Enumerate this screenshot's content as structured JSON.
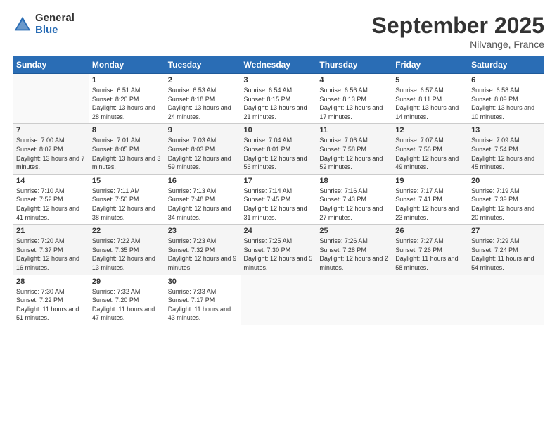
{
  "logo": {
    "general": "General",
    "blue": "Blue"
  },
  "title": "September 2025",
  "location": "Nilvange, France",
  "weekdays": [
    "Sunday",
    "Monday",
    "Tuesday",
    "Wednesday",
    "Thursday",
    "Friday",
    "Saturday"
  ],
  "weeks": [
    [
      {
        "day": "",
        "sunrise": "",
        "sunset": "",
        "daylight": ""
      },
      {
        "day": "1",
        "sunrise": "Sunrise: 6:51 AM",
        "sunset": "Sunset: 8:20 PM",
        "daylight": "Daylight: 13 hours and 28 minutes."
      },
      {
        "day": "2",
        "sunrise": "Sunrise: 6:53 AM",
        "sunset": "Sunset: 8:18 PM",
        "daylight": "Daylight: 13 hours and 24 minutes."
      },
      {
        "day": "3",
        "sunrise": "Sunrise: 6:54 AM",
        "sunset": "Sunset: 8:15 PM",
        "daylight": "Daylight: 13 hours and 21 minutes."
      },
      {
        "day": "4",
        "sunrise": "Sunrise: 6:56 AM",
        "sunset": "Sunset: 8:13 PM",
        "daylight": "Daylight: 13 hours and 17 minutes."
      },
      {
        "day": "5",
        "sunrise": "Sunrise: 6:57 AM",
        "sunset": "Sunset: 8:11 PM",
        "daylight": "Daylight: 13 hours and 14 minutes."
      },
      {
        "day": "6",
        "sunrise": "Sunrise: 6:58 AM",
        "sunset": "Sunset: 8:09 PM",
        "daylight": "Daylight: 13 hours and 10 minutes."
      }
    ],
    [
      {
        "day": "7",
        "sunrise": "Sunrise: 7:00 AM",
        "sunset": "Sunset: 8:07 PM",
        "daylight": "Daylight: 13 hours and 7 minutes."
      },
      {
        "day": "8",
        "sunrise": "Sunrise: 7:01 AM",
        "sunset": "Sunset: 8:05 PM",
        "daylight": "Daylight: 13 hours and 3 minutes."
      },
      {
        "day": "9",
        "sunrise": "Sunrise: 7:03 AM",
        "sunset": "Sunset: 8:03 PM",
        "daylight": "Daylight: 12 hours and 59 minutes."
      },
      {
        "day": "10",
        "sunrise": "Sunrise: 7:04 AM",
        "sunset": "Sunset: 8:01 PM",
        "daylight": "Daylight: 12 hours and 56 minutes."
      },
      {
        "day": "11",
        "sunrise": "Sunrise: 7:06 AM",
        "sunset": "Sunset: 7:58 PM",
        "daylight": "Daylight: 12 hours and 52 minutes."
      },
      {
        "day": "12",
        "sunrise": "Sunrise: 7:07 AM",
        "sunset": "Sunset: 7:56 PM",
        "daylight": "Daylight: 12 hours and 49 minutes."
      },
      {
        "day": "13",
        "sunrise": "Sunrise: 7:09 AM",
        "sunset": "Sunset: 7:54 PM",
        "daylight": "Daylight: 12 hours and 45 minutes."
      }
    ],
    [
      {
        "day": "14",
        "sunrise": "Sunrise: 7:10 AM",
        "sunset": "Sunset: 7:52 PM",
        "daylight": "Daylight: 12 hours and 41 minutes."
      },
      {
        "day": "15",
        "sunrise": "Sunrise: 7:11 AM",
        "sunset": "Sunset: 7:50 PM",
        "daylight": "Daylight: 12 hours and 38 minutes."
      },
      {
        "day": "16",
        "sunrise": "Sunrise: 7:13 AM",
        "sunset": "Sunset: 7:48 PM",
        "daylight": "Daylight: 12 hours and 34 minutes."
      },
      {
        "day": "17",
        "sunrise": "Sunrise: 7:14 AM",
        "sunset": "Sunset: 7:45 PM",
        "daylight": "Daylight: 12 hours and 31 minutes."
      },
      {
        "day": "18",
        "sunrise": "Sunrise: 7:16 AM",
        "sunset": "Sunset: 7:43 PM",
        "daylight": "Daylight: 12 hours and 27 minutes."
      },
      {
        "day": "19",
        "sunrise": "Sunrise: 7:17 AM",
        "sunset": "Sunset: 7:41 PM",
        "daylight": "Daylight: 12 hours and 23 minutes."
      },
      {
        "day": "20",
        "sunrise": "Sunrise: 7:19 AM",
        "sunset": "Sunset: 7:39 PM",
        "daylight": "Daylight: 12 hours and 20 minutes."
      }
    ],
    [
      {
        "day": "21",
        "sunrise": "Sunrise: 7:20 AM",
        "sunset": "Sunset: 7:37 PM",
        "daylight": "Daylight: 12 hours and 16 minutes."
      },
      {
        "day": "22",
        "sunrise": "Sunrise: 7:22 AM",
        "sunset": "Sunset: 7:35 PM",
        "daylight": "Daylight: 12 hours and 13 minutes."
      },
      {
        "day": "23",
        "sunrise": "Sunrise: 7:23 AM",
        "sunset": "Sunset: 7:32 PM",
        "daylight": "Daylight: 12 hours and 9 minutes."
      },
      {
        "day": "24",
        "sunrise": "Sunrise: 7:25 AM",
        "sunset": "Sunset: 7:30 PM",
        "daylight": "Daylight: 12 hours and 5 minutes."
      },
      {
        "day": "25",
        "sunrise": "Sunrise: 7:26 AM",
        "sunset": "Sunset: 7:28 PM",
        "daylight": "Daylight: 12 hours and 2 minutes."
      },
      {
        "day": "26",
        "sunrise": "Sunrise: 7:27 AM",
        "sunset": "Sunset: 7:26 PM",
        "daylight": "Daylight: 11 hours and 58 minutes."
      },
      {
        "day": "27",
        "sunrise": "Sunrise: 7:29 AM",
        "sunset": "Sunset: 7:24 PM",
        "daylight": "Daylight: 11 hours and 54 minutes."
      }
    ],
    [
      {
        "day": "28",
        "sunrise": "Sunrise: 7:30 AM",
        "sunset": "Sunset: 7:22 PM",
        "daylight": "Daylight: 11 hours and 51 minutes."
      },
      {
        "day": "29",
        "sunrise": "Sunrise: 7:32 AM",
        "sunset": "Sunset: 7:20 PM",
        "daylight": "Daylight: 11 hours and 47 minutes."
      },
      {
        "day": "30",
        "sunrise": "Sunrise: 7:33 AM",
        "sunset": "Sunset: 7:17 PM",
        "daylight": "Daylight: 11 hours and 43 minutes."
      },
      {
        "day": "",
        "sunrise": "",
        "sunset": "",
        "daylight": ""
      },
      {
        "day": "",
        "sunrise": "",
        "sunset": "",
        "daylight": ""
      },
      {
        "day": "",
        "sunrise": "",
        "sunset": "",
        "daylight": ""
      },
      {
        "day": "",
        "sunrise": "",
        "sunset": "",
        "daylight": ""
      }
    ]
  ]
}
